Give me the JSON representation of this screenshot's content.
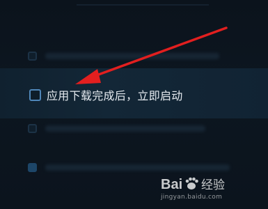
{
  "settings": {
    "option_label": "应用下载完成后，立即启动",
    "option_checked": false
  },
  "watermark": {
    "brand": "Bai",
    "brand_suffix": "经验",
    "url": "jingyan.baidu.com"
  },
  "colors": {
    "background": "#0a121b",
    "highlight_row": "#132737",
    "checkbox_border": "#4f86b8",
    "arrow": "#e21f1f",
    "text": "#e6ebf0"
  }
}
